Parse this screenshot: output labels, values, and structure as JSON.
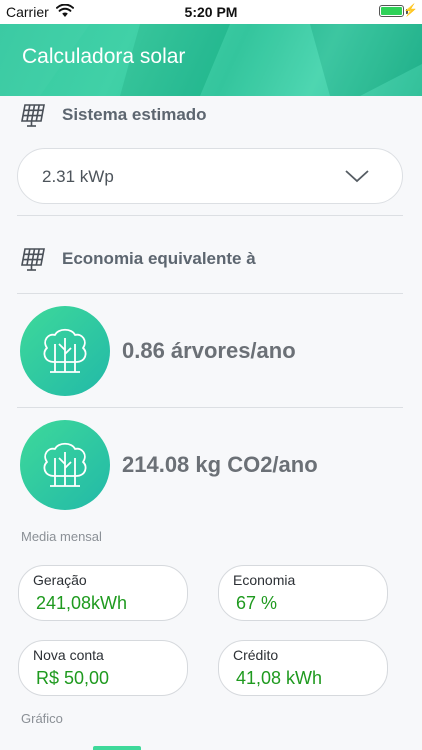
{
  "status_bar": {
    "carrier": "Carrier",
    "time": "5:20 PM",
    "battery_color": "#2fd158"
  },
  "header": {
    "title": "Calculadora solar",
    "color": "#2fc79e"
  },
  "sistema": {
    "title": "Sistema estimado",
    "icon": "solar-panel-icon",
    "select_value": "2.31 kWp",
    "select_icon": "chevron-down-icon"
  },
  "economia": {
    "title": "Economia equivalente à",
    "icon": "solar-panel-icon",
    "items": [
      {
        "icon": "tree-icon",
        "text": "0.86 árvores/ano"
      },
      {
        "icon": "tree-icon",
        "text": "214.08 kg CO2/ano"
      }
    ]
  },
  "media_mensal": {
    "label": "Media mensal",
    "cards": [
      {
        "label": "Geração",
        "value": "241,08kWh"
      },
      {
        "label": "Economia",
        "value": "67 %"
      },
      {
        "label": "Nova conta",
        "value": "R$ 50,00"
      },
      {
        "label": "Crédito",
        "value": "41,08 kWh"
      }
    ],
    "value_color": "#1f9a1f"
  },
  "grafico": {
    "label": "Gráfico"
  }
}
